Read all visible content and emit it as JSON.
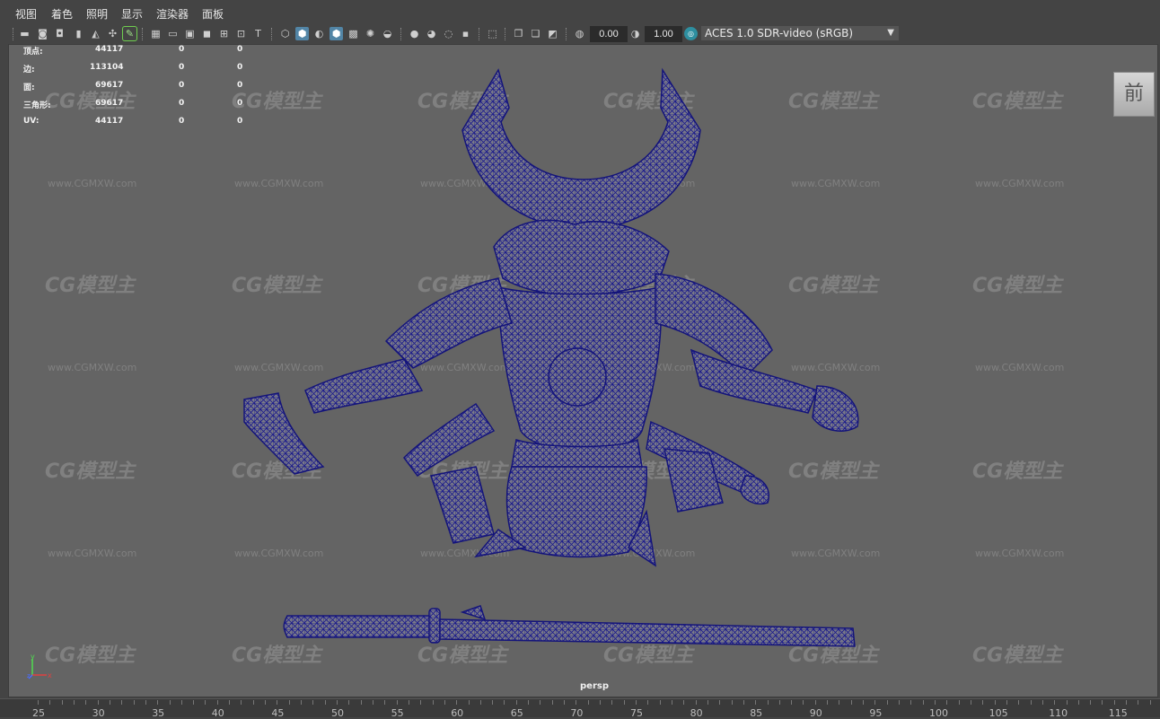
{
  "menu": [
    "视图",
    "着色",
    "照明",
    "显示",
    "渲染器",
    "面板"
  ],
  "toolbar": {
    "exposure": "0.00",
    "gamma": "1.00",
    "colorspace": "ACES 1.0 SDR-video (sRGB)"
  },
  "hud": {
    "rows": [
      {
        "label": "顶点:",
        "v1": "44117",
        "v2": "0",
        "v3": "0"
      },
      {
        "label": "边:",
        "v1": "113104",
        "v2": "0",
        "v3": "0"
      },
      {
        "label": "面:",
        "v1": "69617",
        "v2": "0",
        "v3": "0"
      },
      {
        "label": "三角形:",
        "v1": "69617",
        "v2": "0",
        "v3": "0"
      },
      {
        "label": "UV:",
        "v1": "44117",
        "v2": "0",
        "v3": "0"
      }
    ]
  },
  "viewcube": {
    "face": "前"
  },
  "camera": "persp",
  "watermark": {
    "logo": "CG模型主",
    "url": "www.CGMXW.com"
  },
  "axis": {
    "x": "x",
    "y": "y",
    "z": "z"
  },
  "timeline": {
    "ticks": [
      "25",
      "30",
      "35",
      "40",
      "45",
      "50",
      "55",
      "60",
      "65",
      "70",
      "75",
      "80",
      "85",
      "90",
      "95",
      "100",
      "105",
      "110",
      "115"
    ]
  },
  "colors": {
    "wireframe": "#1a1a8c",
    "viewport_bg": "#646464",
    "ui_bg": "#444444"
  }
}
